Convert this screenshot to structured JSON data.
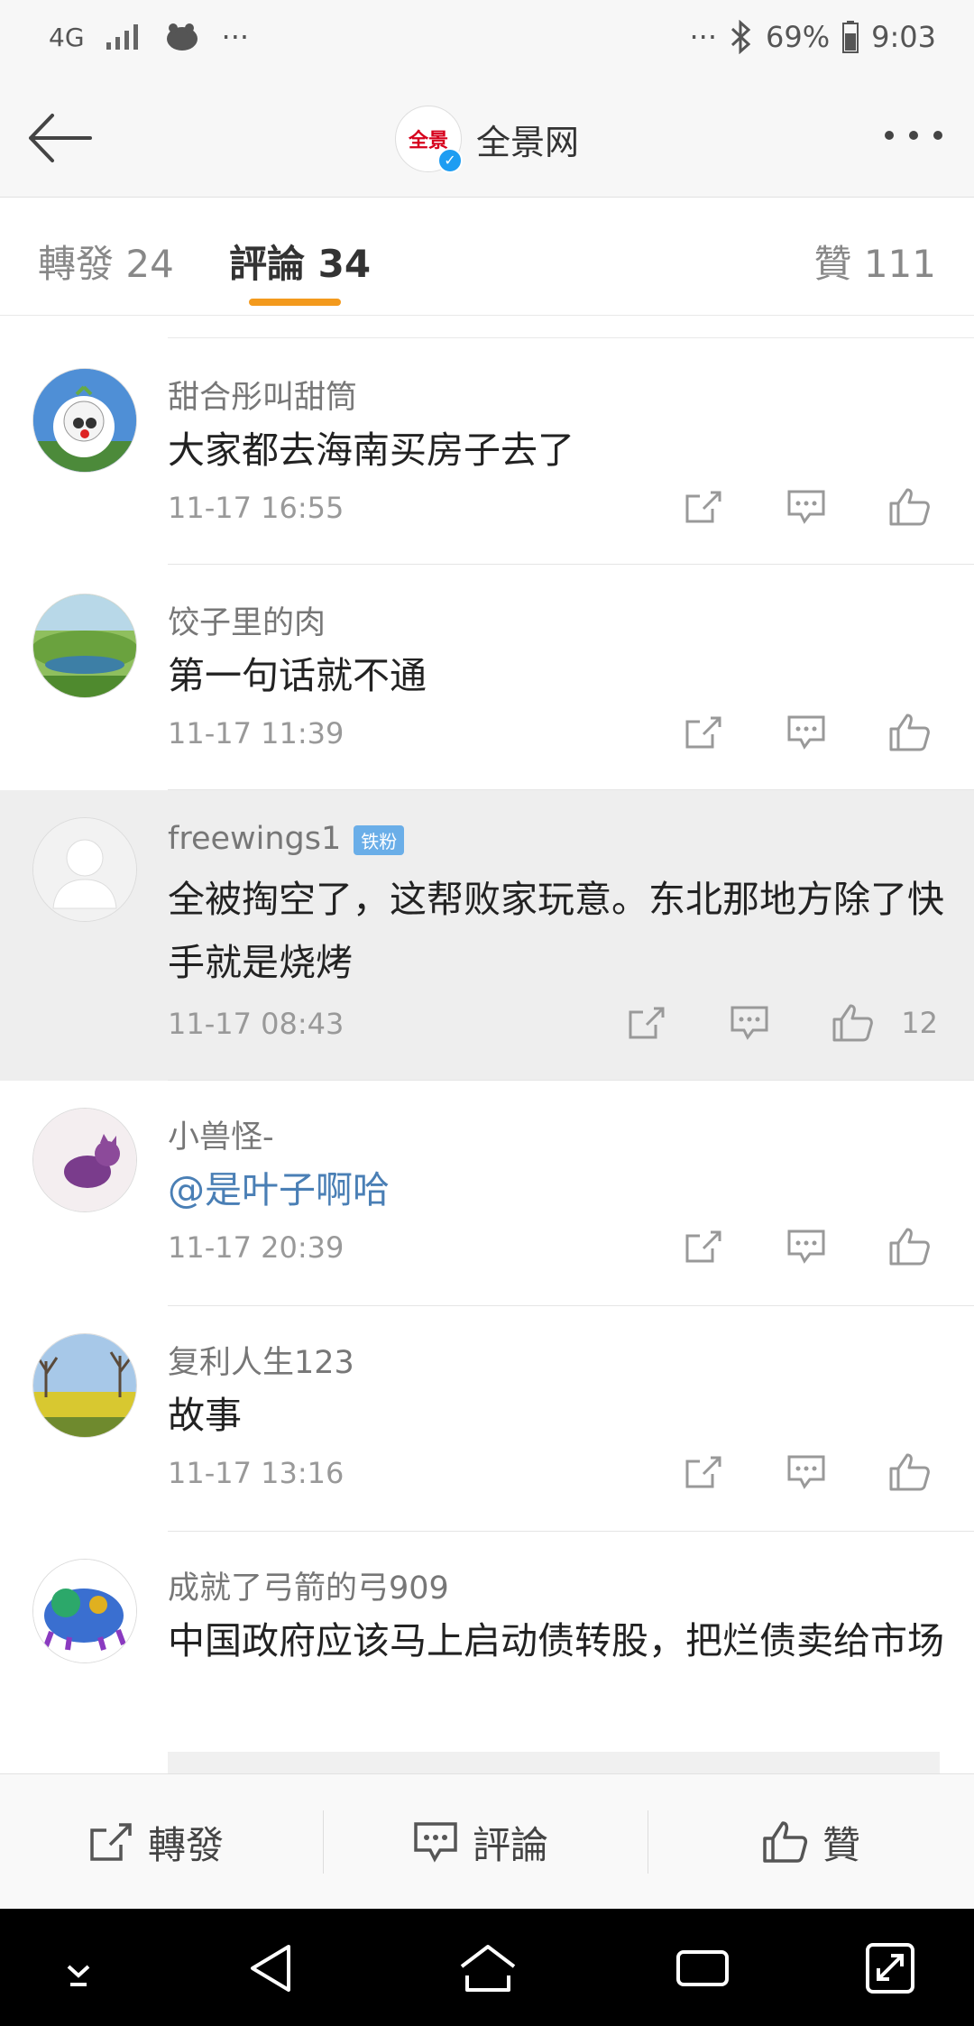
{
  "status": {
    "network": "4G",
    "battery": "69%",
    "time": "9:03",
    "overflow_left": "···",
    "overflow_right": "···"
  },
  "nav": {
    "title": "全景网",
    "logo_text": "全景"
  },
  "tabs": [
    {
      "label": "轉發 24",
      "active": false
    },
    {
      "label": "評論 34",
      "active": true
    },
    {
      "label": "贊 111",
      "active": false
    }
  ],
  "comments": [
    {
      "username": "甜合彤叫甜筒",
      "text": "大家都去海南买房子去了",
      "time": "11-17 16:55",
      "likes": "",
      "badge": "",
      "mention": false
    },
    {
      "username": "饺子里的肉",
      "text": "第一句话就不通",
      "time": "11-17 11:39",
      "likes": "",
      "badge": "",
      "mention": false
    },
    {
      "username": "freewings1",
      "text": "全被掏空了，这帮败家玩意。东北那地方除了快手就是烧烤",
      "time": "11-17 08:43",
      "likes": "12",
      "badge": "铁粉",
      "mention": false
    },
    {
      "username": "小兽怪-",
      "text": "@是叶子啊哈",
      "time": "11-17 20:39",
      "likes": "",
      "badge": "",
      "mention": true
    },
    {
      "username": "复利人生123",
      "text": "故事",
      "time": "11-17 13:16",
      "likes": "",
      "badge": "",
      "mention": false
    },
    {
      "username": "成就了弓箭的弓909",
      "text": "中国政府应该马上启动债转股，把烂债卖给市场",
      "time": "",
      "likes": "",
      "badge": "",
      "mention": false
    }
  ],
  "bottom": {
    "repost": "轉發",
    "comment": "評論",
    "like": "贊"
  },
  "colors": {
    "accent": "#f39a1d",
    "mention": "#4a7fb5",
    "verified": "#1e9df2",
    "badge": "#6aaee8"
  }
}
